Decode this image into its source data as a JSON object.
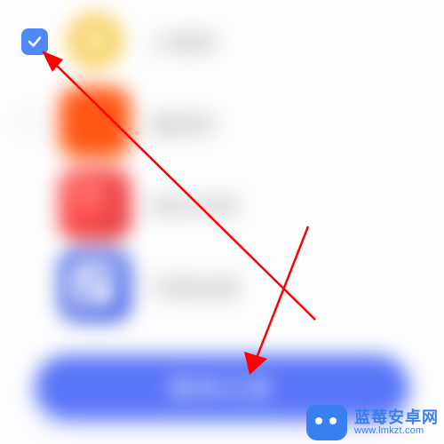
{
  "checkbox": {
    "checked": true
  },
  "apps": [
    {
      "label": "小程序"
    },
    {
      "label": "番茄时"
    },
    {
      "label": "拼多多商"
    },
    {
      "label": "中国出版"
    }
  ],
  "button": {
    "delete_label": "删除记录"
  },
  "watermark": {
    "cn": "蓝莓安卓网",
    "url": "www.lmkzt.com"
  },
  "annotations": {
    "arrow1": "points to checkbox",
    "arrow2": "points to delete button"
  }
}
